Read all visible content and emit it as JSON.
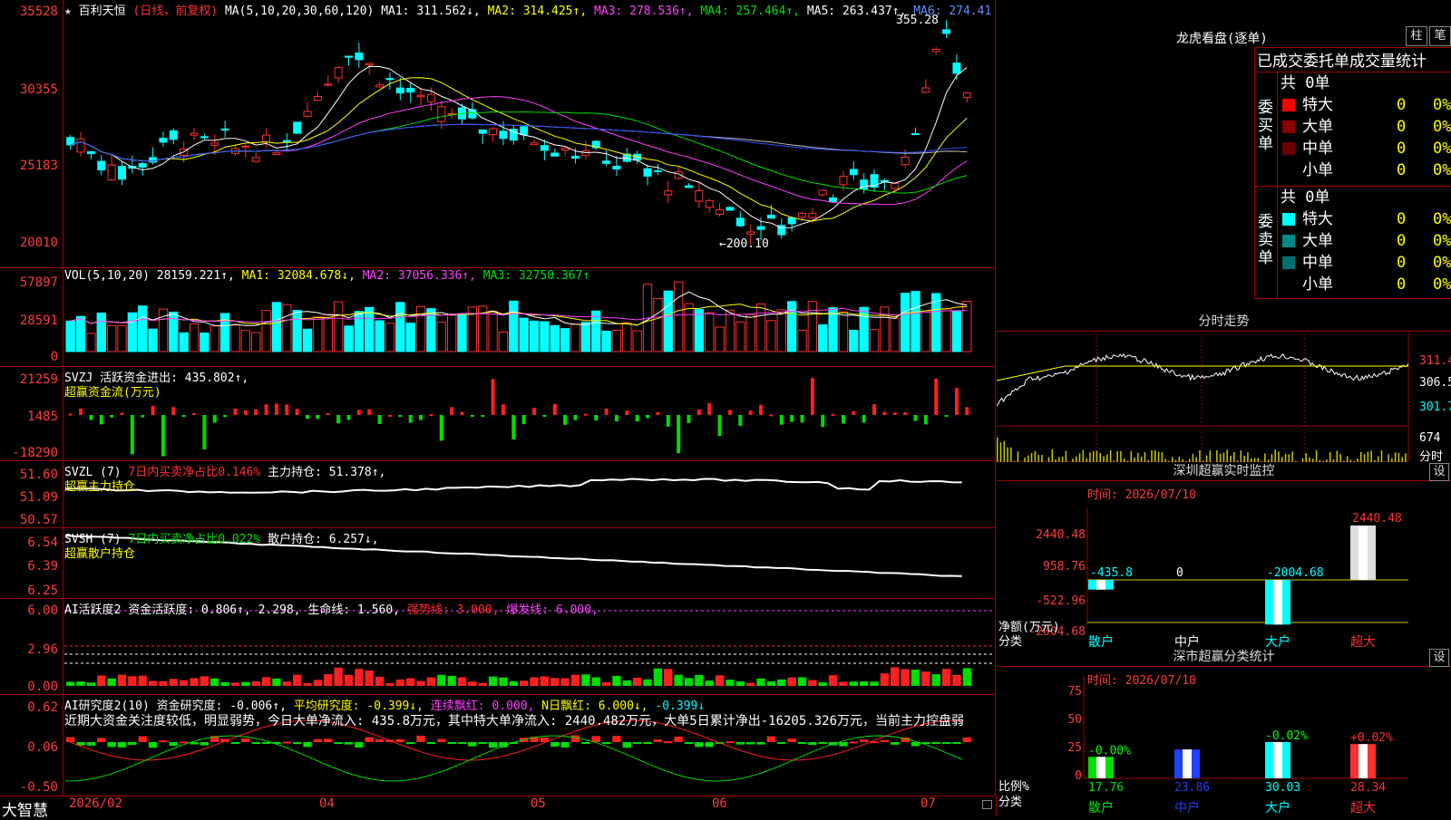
{
  "stock": {
    "name": "百利天恒",
    "period": "(日线，前复权)"
  },
  "kline": {
    "ma_text": "MA(5,10,20,30,60,120)",
    "ma1": "MA1: 311.562↓,",
    "ma2": "MA2: 314.425↑,",
    "ma3": "MA3: 278.536↑,",
    "ma4": "MA4: 257.464↑,",
    "ma5": "MA5: 263.437↑,",
    "ma6": "MA6: 274.41",
    "yticks": [
      "35528",
      "30355",
      "25183",
      "20010"
    ],
    "high_label": "355.28",
    "low_label": "←200.10"
  },
  "vol": {
    "title": "VOL(5,10,20)",
    "val": "28159.221↑,",
    "ma1": "MA1: 32084.678↓,",
    "ma2": "MA2: 37056.336↑,",
    "ma3": "MA3: 32750.367↑",
    "yticks": [
      "57897",
      "28591",
      "0"
    ]
  },
  "svzj": {
    "title": "SVZJ",
    "t1": "活跃资金进出: 435.802↑,",
    "t2": "超赢资金流(万元)",
    "yticks": [
      "21259",
      "1485",
      "-18290"
    ]
  },
  "svzl": {
    "title": "SVZL (7)",
    "t1": "7日内买卖净占比0.146%",
    "t2": "主力持仓: 51.378↑,",
    "t3": "超赢主力持仓",
    "yticks": [
      "51.60",
      "51.09",
      "50.57"
    ]
  },
  "svsh": {
    "title": "SVSH (7)",
    "t1": "7日内买卖净占比0.022%",
    "t2": "散户持仓: 6.257↓,",
    "t3": "超赢散户持仓",
    "yticks": [
      "6.54",
      "6.39",
      "6.25"
    ]
  },
  "ai1": {
    "title": "AI活跃度2",
    "t1": "资金活跃度: 0.806↑,",
    "t2": "2.298,",
    "t3": "生命线: 1.560,",
    "t4": "强势线: 3.000,",
    "t5": "爆发线: 6.000,",
    "yticks": [
      "6.00",
      "2.96",
      "0.00"
    ]
  },
  "ai2": {
    "title": "AI研究度2(10)",
    "t1": "资金研究度: -0.006↑,",
    "t2": "平均研究度: -0.399↓,",
    "t3": "连续飘红: 0.000,",
    "t4": "N日飘红: 6.000↓,",
    "t5": "-0.399↓",
    "comment": "近期大资金关注度较低，明显弱势，今日大单净流入: 435.8万元，其中特大单净流入: 2440.482万元，大单5日累计净出-16205.326万元，当前主力控盘弱",
    "yticks": [
      "0.62",
      "0.06",
      "-0.50"
    ]
  },
  "dates": {
    "brand": "大智慧",
    "d1": "2026/02",
    "d2": "04",
    "d3": "05",
    "d4": "06",
    "d5": "07"
  },
  "dragon": {
    "title": "龙虎看盘(逐单)",
    "btn1": "柱",
    "btn2": "笔",
    "subtitle": "已成交委托单成交量统计",
    "buy_label": "委买单",
    "sell_label": "委卖单",
    "buy_total": "共 0单",
    "sell_total": "共 0单",
    "buy_rows": [
      {
        "name": "特大",
        "v": "0",
        "p": "0%"
      },
      {
        "name": "大单",
        "v": "0",
        "p": "0%"
      },
      {
        "name": "中单",
        "v": "0",
        "p": "0%"
      },
      {
        "name": "小单",
        "v": "0",
        "p": "0%"
      }
    ],
    "sell_rows": [
      {
        "name": "特大",
        "v": "0",
        "p": "0%"
      },
      {
        "name": "大单",
        "v": "0",
        "p": "0%"
      },
      {
        "name": "中单",
        "v": "0",
        "p": "0%"
      },
      {
        "name": "小单",
        "v": "0",
        "p": "0%"
      }
    ],
    "colors": {
      "buy": [
        "#ff0000",
        "#8b0000",
        "#6b0000",
        "#000"
      ],
      "sell": [
        "#00ffff",
        "#008b8b",
        "#007070",
        "#000"
      ]
    }
  },
  "intraday": {
    "title": "分时走势",
    "yticks": [
      "311.4",
      "306.5",
      "301.7",
      "674"
    ],
    "unit": "分时"
  },
  "monitor": {
    "title": "深圳超赢实时监控",
    "btn": "设",
    "time": "时间: 2026/07/10",
    "yticks": [
      "2440.48",
      "958.76",
      "-522.96",
      "-2004.68"
    ],
    "net_label": "净额(万元)",
    "cat_label": "分类",
    "cats": [
      "散户",
      "中户",
      "大户",
      "超大"
    ],
    "values": [
      "-435.8",
      "0",
      "-2004.68",
      "2440.48"
    ]
  },
  "classify": {
    "title": "深市超赢分类统计",
    "btn": "设",
    "time": "时间: 2026/07/10",
    "yticks": [
      "75",
      "50",
      "25",
      "0"
    ],
    "ratio_label": "比例%",
    "cat_label": "分类",
    "cats": [
      "散户",
      "中户",
      "大户",
      "超大"
    ],
    "values": [
      "17.76",
      "23.86",
      "30.03",
      "28.34"
    ],
    "changes": [
      "-0.00%",
      "",
      "-0.02%",
      "+0.02%"
    ]
  }
}
